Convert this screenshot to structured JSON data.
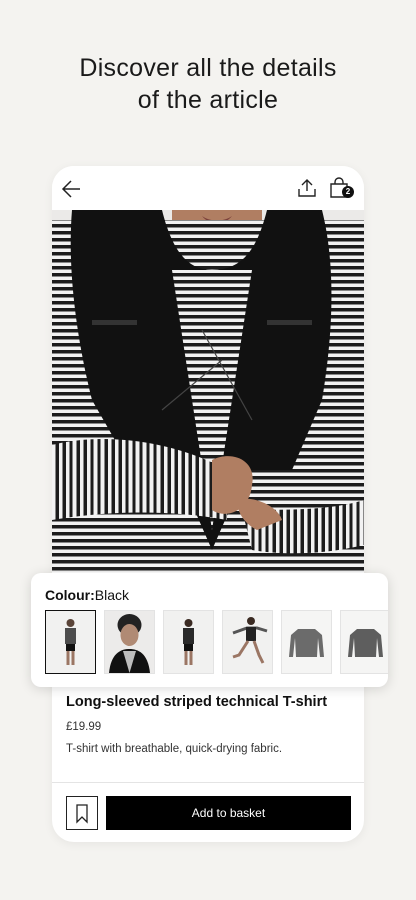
{
  "headline": {
    "line1": "Discover all the details",
    "line2": "of the article"
  },
  "topbar": {
    "back_icon": "arrow-left-icon",
    "share_icon": "share-icon",
    "bag_icon": "shopping-bag-icon",
    "bag_count": "2"
  },
  "colour": {
    "label": "Colour:",
    "value": "Black",
    "swatches": [
      {
        "icon": "model-front-thumbnail",
        "selected": true
      },
      {
        "icon": "model-closeup-thumbnail",
        "selected": false
      },
      {
        "icon": "model-back-thumbnail",
        "selected": false
      },
      {
        "icon": "model-running-thumbnail",
        "selected": false
      },
      {
        "icon": "shirt-flat-front-thumbnail",
        "selected": false
      },
      {
        "icon": "shirt-flat-back-thumbnail",
        "selected": false
      }
    ]
  },
  "product": {
    "name": "Long-sleeved striped technical T-shirt",
    "price": "£19.99",
    "description": "T-shirt with breathable, quick-drying fabric."
  },
  "actions": {
    "wishlist_icon": "bookmark-icon",
    "add_to_basket": "Add to basket"
  },
  "colors": {
    "background": "#f4f3f0",
    "primary_button": "#000000",
    "vest": "#111111"
  }
}
